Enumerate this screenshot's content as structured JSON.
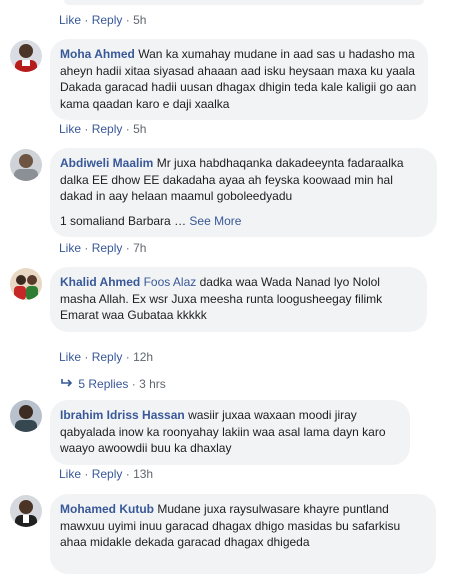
{
  "top": {
    "like": "Like",
    "reply": "Reply",
    "time": "5h"
  },
  "comments": [
    {
      "author": "Moha Ahmed",
      "tag": "",
      "text": "Wan ka xumahay mudane in aad sas u hadasho ma aheyn hadii xitaa siyasad ahaaan aad isku heysaan maxa ku yaala Dakada garacad hadii uusan dhagax dhigin teda kale kaligii go aan kama qaadan karo e daji xaalka",
      "extra": "",
      "like": "Like",
      "reply": "Reply",
      "time": "5h"
    },
    {
      "author": "Abdiweli Maalim",
      "tag": "",
      "text": "Mr juxa habdhaqanka dakadeeynta fadaraalka dalka EE dhow EE dakadaha ayaa ah feyska koowaad min hal dakad in aay helaan maamul goboleedyadu",
      "extra": "1 somaliand Barbara …",
      "see_more": "See More",
      "like": "Like",
      "reply": "Reply",
      "time": "7h"
    },
    {
      "author": "Khalid Ahmed",
      "tag": "Foos Alaz",
      "text": "dadka waa Wada Nanad lyo Nolol masha Allah. Ex wsr Juxa meesha runta loogusheegay filimk Emarat waa Gubataa kkkkk",
      "like": "Like",
      "reply": "Reply",
      "time": "12h"
    },
    {
      "author": "Ibrahim Idriss Hassan",
      "tag": "",
      "text": "wasiir juxaa waxaan moodi jiray qabyalada inow ka roonyahay lakiin waa asal lama dayn karo waayo awoowdii buu ka dhaxlay",
      "like": "Like",
      "reply": "Reply",
      "time": "13h"
    },
    {
      "author": "Mohamed Kutub",
      "tag": "",
      "text": "Mudane juxa raysulwasare khayre puntland mawxuu uyimi inuu garacad dhagax dhigo masidas bu safarkisu ahaa midakle dekada garacad dhagax dhigeda",
      "like": "",
      "reply": "",
      "time": ""
    }
  ],
  "replies": {
    "label": "5 Replies",
    "time": "3 hrs"
  },
  "dot": "·"
}
